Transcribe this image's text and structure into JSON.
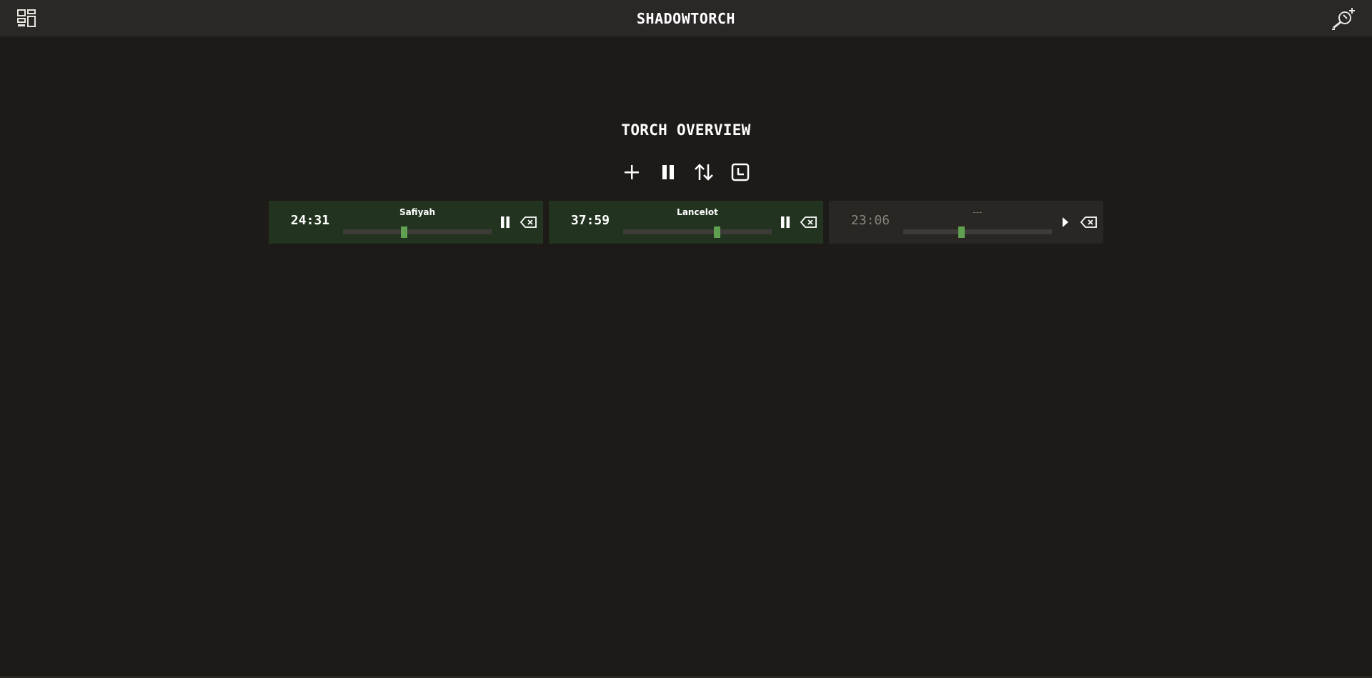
{
  "app": {
    "title": "SHADOWTORCH"
  },
  "header": {
    "menu_icon": "dashboard-grid-icon",
    "torch_icon": "light-torch-add-icon"
  },
  "main": {
    "heading": "TORCH OVERVIEW",
    "toolbar": [
      {
        "name": "add-torch-button",
        "icon": "plus-icon"
      },
      {
        "name": "pause-all-button",
        "icon": "pause-icon"
      },
      {
        "name": "sort-button",
        "icon": "sort-arrows-icon"
      },
      {
        "name": "timer-button",
        "icon": "clock-icon"
      }
    ]
  },
  "torches": [
    {
      "time": "24:31",
      "name": "Safiyah",
      "active": true,
      "progress": 0.41,
      "control_icon": "pause-icon",
      "delete_icon": "backspace-delete-icon"
    },
    {
      "time": "37:59",
      "name": "Lancelot",
      "active": true,
      "progress": 0.63,
      "control_icon": "pause-icon",
      "delete_icon": "backspace-delete-icon"
    },
    {
      "time": "23:06",
      "name": "---",
      "active": false,
      "progress": 0.39,
      "control_icon": "play-icon",
      "delete_icon": "backspace-delete-icon"
    }
  ],
  "colors": {
    "background": "#1e1a18",
    "topbar": "#2a2726",
    "active_card": "#22341f",
    "inactive_card": "#292624",
    "slider_track": "#3d3c39",
    "slider_knob": "#5fa150"
  }
}
